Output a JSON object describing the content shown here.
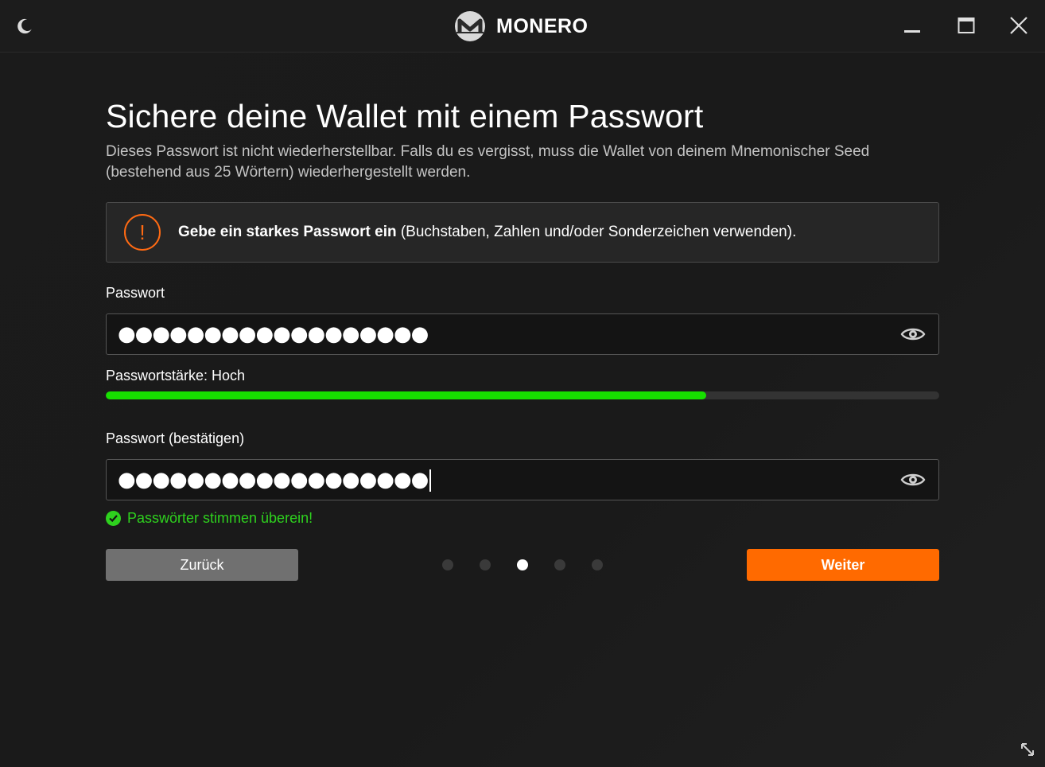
{
  "app": {
    "name": "MONERO",
    "accent_color": "#ff6a00",
    "success_color": "#2ed11e"
  },
  "titlebar": {
    "theme_icon": "moon-icon",
    "minimize_icon": "minimize-icon",
    "maximize_icon": "maximize-icon",
    "close_icon": "close-icon"
  },
  "page": {
    "title": "Sichere deine Wallet mit einem Passwort",
    "description": "Dieses Passwort ist nicht wiederherstellbar. Falls du es vergisst, muss die Wallet von deinem Mnemonischer Seed (bestehend aus 25 Wörtern) wiederhergestellt werden."
  },
  "warning": {
    "icon": "warning-circle-icon",
    "text_bold": "Gebe ein starkes Passwort ein",
    "text_rest": " (Buchstaben, Zahlen und/oder Sonderzeichen verwenden)."
  },
  "password": {
    "label": "Passwort",
    "masked_value": "●●●●●●●●●●●●●●●●●●",
    "reveal_icon": "eye-icon"
  },
  "strength": {
    "label": "Passwortstärke: Hoch",
    "fraction": 0.72,
    "color": "#17e000"
  },
  "confirm": {
    "label": "Passwort (bestätigen)",
    "masked_value": "●●●●●●●●●●●●●●●●●●",
    "reveal_icon": "eye-icon"
  },
  "match_message": {
    "icon": "check-circle-icon",
    "text": "Passwörter stimmen überein!"
  },
  "navigation": {
    "back_label": "Zurück",
    "next_label": "Weiter",
    "steps_total": 5,
    "current_step": 3
  }
}
